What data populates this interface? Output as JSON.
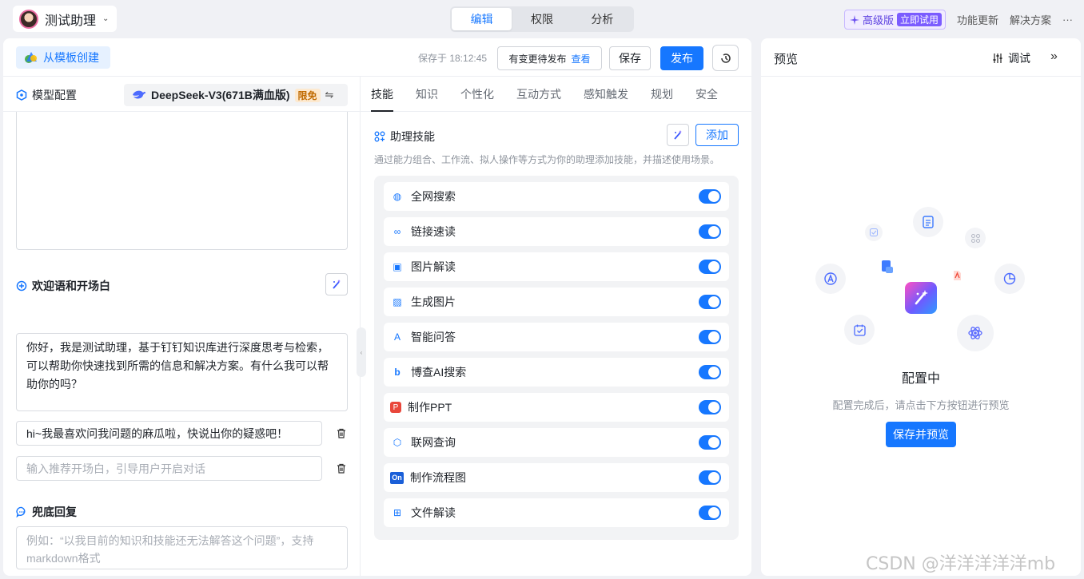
{
  "header": {
    "assistant_name": "测试助理",
    "caret": "⌄",
    "mode_tabs": [
      {
        "label": "编辑",
        "active": true
      },
      {
        "label": "权限",
        "active": false
      },
      {
        "label": "分析",
        "active": false
      }
    ],
    "pro_label": "高级版",
    "pro_cta": "立即试用",
    "feature_updates": "功能更新",
    "solutions": "解决方案",
    "more": "···"
  },
  "toolbar": {
    "template_button": "从模板创建",
    "saved_at": "保存于 18:12:45",
    "pending_publish": "有变更待发布",
    "pending_view": "查看",
    "save": "保存",
    "publish": "发布"
  },
  "model": {
    "section_title": "模型配置",
    "model_name": "DeepSeek-V3(671B满血版)",
    "free_tag": "限免",
    "swap_icon": "⇋"
  },
  "welcome": {
    "section_title": "欢迎语和开场白",
    "message": "你好，我是测试助理，基于钉钉知识库进行深度思考与检索，可以帮助你快速找到所需的信息和解决方案。有什么我可以帮助你的吗？",
    "opener_value": "hi~我最喜欢问我问题的麻瓜啦，快说出你的疑惑吧！",
    "opener_placeholder": "输入推荐开场白，引导用户开启对话"
  },
  "fallback": {
    "section_title": "兜底回复",
    "placeholder": "例如：“以我目前的知识和技能还无法解答这个问题”，支持markdown格式"
  },
  "config_tabs": [
    {
      "label": "技能",
      "active": true
    },
    {
      "label": "知识",
      "active": false
    },
    {
      "label": "个性化",
      "active": false
    },
    {
      "label": "互动方式",
      "active": false
    },
    {
      "label": "感知触发",
      "active": false
    },
    {
      "label": "规划",
      "active": false
    },
    {
      "label": "安全",
      "active": false
    }
  ],
  "skills": {
    "section_title": "助理技能",
    "add_button": "添加",
    "description": "通过能力组合、工作流、拟人操作等方式为你的助理添加技能，并描述使用场景。",
    "items": [
      {
        "label": "全网搜索",
        "icon": "globe-icon",
        "glyph": "◍",
        "enabled": true
      },
      {
        "label": "链接速读",
        "icon": "link-icon",
        "glyph": "∞",
        "enabled": true
      },
      {
        "label": "图片解读",
        "icon": "image-scan-icon",
        "glyph": "▣",
        "enabled": true
      },
      {
        "label": "生成图片",
        "icon": "image-icon",
        "glyph": "▨",
        "enabled": true
      },
      {
        "label": "智能问答",
        "icon": "a-logo-icon",
        "glyph": "A",
        "enabled": true
      },
      {
        "label": "博查AI搜索",
        "icon": "bocha-icon",
        "glyph": "b",
        "enabled": true
      },
      {
        "label": "制作PPT",
        "icon": "ppt-icon",
        "glyph": "P",
        "enabled": true
      },
      {
        "label": "联网查询",
        "icon": "cube-icon",
        "glyph": "⬡",
        "enabled": true
      },
      {
        "label": "制作流程图",
        "icon": "flowchart-icon",
        "glyph": "On",
        "enabled": true
      },
      {
        "label": "文件解读",
        "icon": "file-icon",
        "glyph": "⊞",
        "enabled": true
      }
    ]
  },
  "preview": {
    "title": "预览",
    "debug": "调试",
    "status": "配置中",
    "hint": "配置完成后，请点击下方按钮进行预览",
    "button": "保存并预览",
    "collapse": "»"
  },
  "watermark": "CSDN @洋洋洋洋洋mb",
  "colors": {
    "accent": "#1677ff",
    "pro": "#7b5cff",
    "free_tag_bg": "#fde9cf"
  }
}
